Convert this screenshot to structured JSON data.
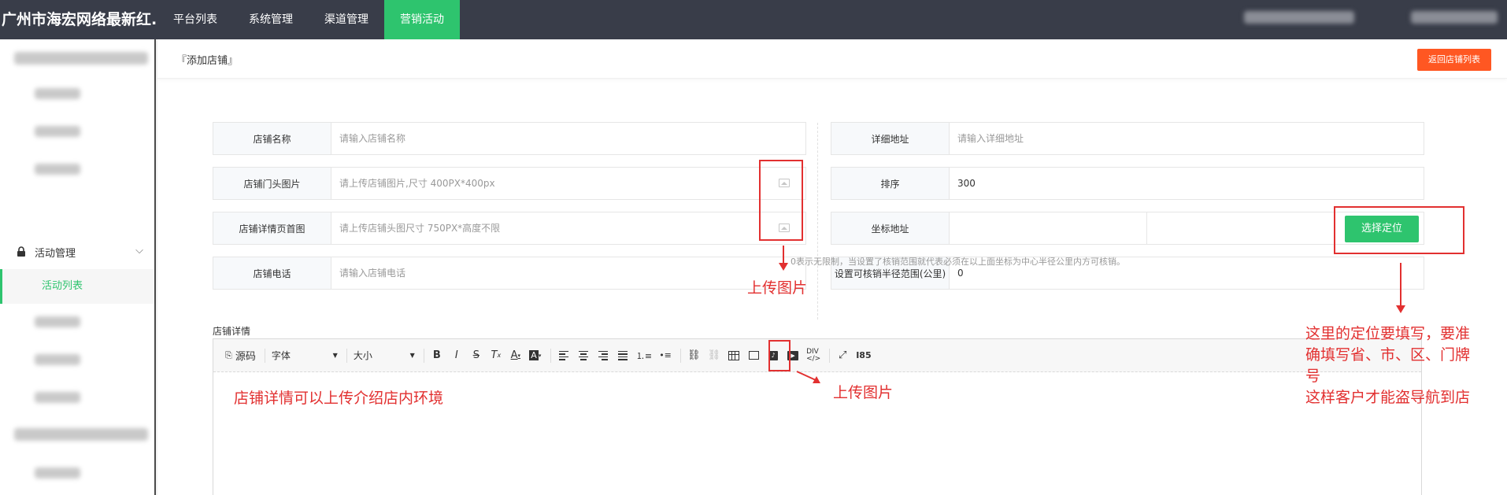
{
  "header": {
    "brand": "广州市海宏网络最新红...",
    "nav": [
      {
        "label": "平台列表",
        "active": false
      },
      {
        "label": "系统管理",
        "active": false
      },
      {
        "label": "渠道管理",
        "active": false
      },
      {
        "label": "营销活动",
        "active": true
      }
    ]
  },
  "sidebar": {
    "group_label": "活动管理",
    "active_item": "活动列表"
  },
  "page": {
    "breadcrumb": "『添加店铺』",
    "back_button": "返回店铺列表"
  },
  "form": {
    "store_name": {
      "label": "店铺名称",
      "placeholder": "请输入店铺名称"
    },
    "door_image": {
      "label": "店铺门头图片",
      "placeholder": "请上传店铺图片,尺寸 400PX*400px"
    },
    "detail_image": {
      "label": "店铺详情页首图",
      "placeholder": "请上传店铺头图尺寸 750PX*高度不限"
    },
    "phone": {
      "label": "店铺电话",
      "placeholder": "请输入店铺电话"
    },
    "address": {
      "label": "详细地址",
      "placeholder": "请输入详细地址"
    },
    "sort": {
      "label": "排序",
      "value": "300"
    },
    "coords": {
      "label": "坐标地址",
      "button": "选择定位"
    },
    "radius": {
      "label": "设置可核销半径范围(公里)",
      "value": "0"
    },
    "radius_hint": "0表示无限制，当设置了核销范围就代表必须在以上面坐标为中心半径公里内方可核销。",
    "detail_label": "店铺详情"
  },
  "editor": {
    "source_label": "源码",
    "font_label": "字体",
    "size_label": "大小"
  },
  "annotations": {
    "upload1": "上传图片",
    "upload2": "上传图片",
    "detail_note": "店铺详情可以上传介绍店内环境",
    "location_note_1": "这里的定位要填写，要准",
    "location_note_2": "确填写省、市、区、门牌",
    "location_note_3": "号",
    "location_note_4": "这样客户才能盗导航到店"
  },
  "colors": {
    "topbar": "#393d49",
    "accent": "#2ec46e",
    "danger_button": "#ff5722",
    "annotation": "#e23030"
  }
}
